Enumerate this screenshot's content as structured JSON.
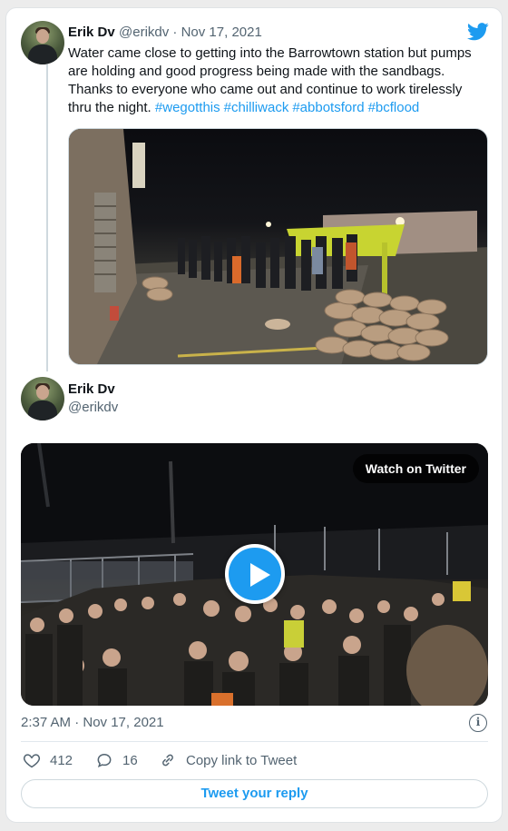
{
  "tweet": {
    "author_name": "Erik Dv",
    "author_handle": "@erikdv",
    "separator": "·",
    "date": "Nov 17, 2021",
    "text": "Water came close to getting into the Barrowtown station but pumps are holding and good progress being made with the sandbags. Thanks to everyone who came out and continue to work tirelessly thru the night.",
    "hashtags": [
      "#wegotthis",
      "#chilliwack",
      "#abbotsford",
      "#bcflood"
    ]
  },
  "reply_tweet": {
    "author_name": "Erik Dv",
    "author_handle": "@erikdv",
    "video": {
      "watch_label": "Watch on Twitter"
    },
    "timestamp": "2:37 AM · Nov 17, 2021"
  },
  "actions": {
    "likes": "412",
    "replies": "16",
    "copy_link_label": "Copy link to Tweet",
    "reply_button_label": "Tweet your reply"
  },
  "colors": {
    "accent": "#1d9bf0",
    "muted_text": "#536471",
    "text": "#0f1419"
  },
  "icons": [
    "twitter-bird-icon",
    "info-icon",
    "heart-icon",
    "reply-icon",
    "link-icon",
    "play-icon"
  ]
}
